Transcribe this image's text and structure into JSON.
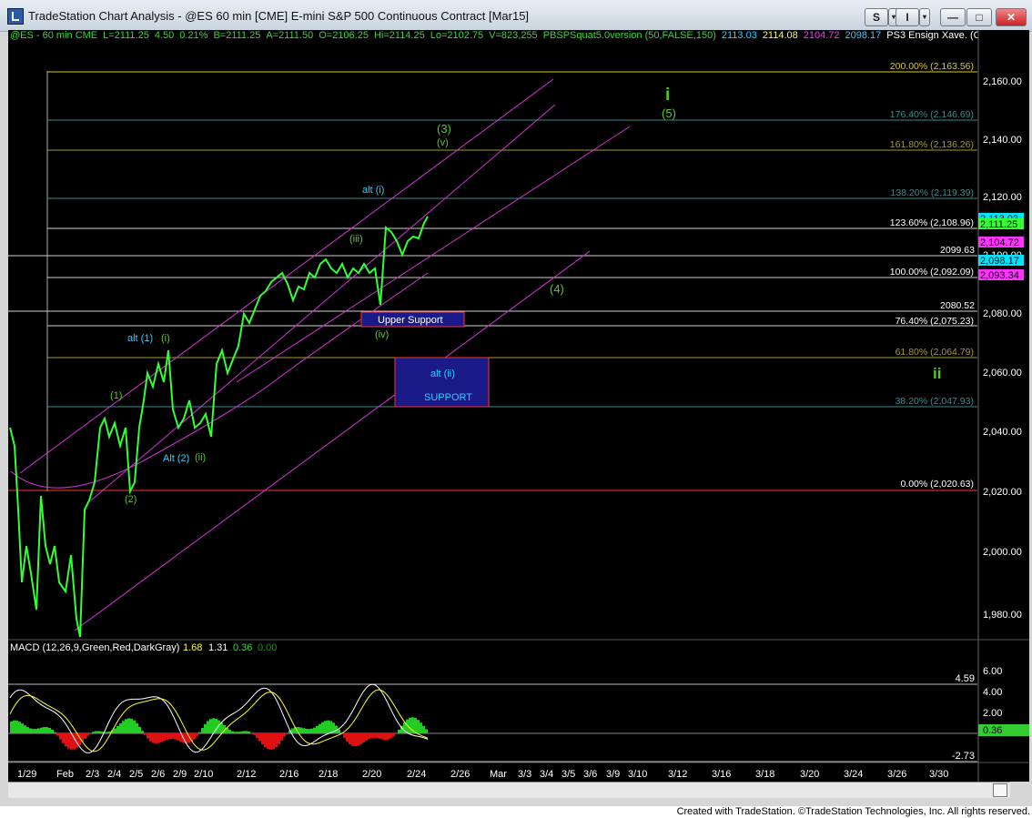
{
  "window": {
    "title": "TradeStation Chart Analysis - @ES 60 min [CME] E-mini S&P 500 Continuous Contract [Mar15]",
    "buttons": {
      "s": "S",
      "i": "I"
    }
  },
  "status_line": [
    {
      "text": "@ES - 60 min  CME",
      "color": "#39d639"
    },
    {
      "text": "L=2111.25",
      "color": "#39d639"
    },
    {
      "text": "4.50",
      "color": "#39d639"
    },
    {
      "text": "0.21%",
      "color": "#39d639"
    },
    {
      "text": "B=2111.25",
      "color": "#39d639"
    },
    {
      "text": "A=2111.50",
      "color": "#39d639"
    },
    {
      "text": "O=2106.25",
      "color": "#39d639"
    },
    {
      "text": "Hi=2114.25",
      "color": "#39d639"
    },
    {
      "text": "Lo=2102.75",
      "color": "#39d639"
    },
    {
      "text": "V=823,255",
      "color": "#39d639"
    },
    {
      "text": "PBSPSquat5.0version (50,FALSE,150)",
      "color": "#39d639"
    },
    {
      "text": "2113.03",
      "color": "#33ccff"
    },
    {
      "text": "2114.08",
      "color": "#ffff33"
    },
    {
      "text": "2104.72",
      "color": "#ff33ff"
    },
    {
      "text": "2098.17",
      "color": "#33ccff"
    },
    {
      "text": "PS3 Ensign Xave. (C",
      "color": "#ffffff"
    }
  ],
  "price_axis": {
    "ticks": [
      "2,160.00",
      "2,140.00",
      "2,120.00",
      "2,100.00",
      "2,080.00",
      "2,060.00",
      "2,040.00",
      "2,020.00",
      "2,000.00",
      "1,980.00"
    ],
    "tags": [
      {
        "text": "2,113.03",
        "bg": "#00e5ff"
      },
      {
        "text": "2,111.25",
        "bg": "#33ff33"
      },
      {
        "text": "2,104.72",
        "bg": "#ff33ff"
      },
      {
        "text": "2,098.17",
        "bg": "#00e5ff"
      },
      {
        "text": "2,093.34",
        "bg": "#ff33ff"
      }
    ]
  },
  "fib_levels": [
    {
      "label": "200.00% (2,163.56)",
      "color": "#d6c832"
    },
    {
      "label": "176.40% (2,146.69)",
      "color": "#3d8a8a"
    },
    {
      "label": "161.80% (2,136.26)",
      "color": "#a39a3a"
    },
    {
      "label": "138.20% (2,119.39)",
      "color": "#3d8a8a"
    },
    {
      "label": "123.60% (2,108.96)",
      "color": "#ffffff"
    },
    {
      "label": "100.00% (2,092.09)",
      "color": "#ffffff"
    },
    {
      "label": "76.40% (2,075.23)",
      "color": "#ffffff"
    },
    {
      "label": "61.80% (2,064.79)",
      "color": "#a39a3a"
    },
    {
      "label": "38.20% (2,047.93)",
      "color": "#3d8a8a"
    },
    {
      "label": "0.00% (2,020.63)",
      "color": "#ffffff"
    }
  ],
  "level_labels": [
    "2099.63",
    "2080.52"
  ],
  "wave_labels": {
    "big_i": "i",
    "five": "(5)",
    "three": "(3)",
    "v": "(v)",
    "alt_i": "alt (i)",
    "iii": "(iii)",
    "four": "(4)",
    "iv": "(iv)",
    "alt_1": "alt (1)",
    "i_small": "(i)",
    "one": "(1)",
    "alt_2": "Alt (2)",
    "ii_small": "(ii)",
    "two": "(2)",
    "big_ii": "ii"
  },
  "boxes": {
    "upper_support": "Upper Support",
    "alt_ii": "alt (ii)",
    "support": "SUPPORT"
  },
  "macd": {
    "title": "MACD (12,26,9,Green,Red,DarkGray)",
    "values": [
      {
        "text": "1.68",
        "color": "#ffff33"
      },
      {
        "text": "1.31",
        "color": "#ffffff"
      },
      {
        "text": "0.36",
        "color": "#39d639"
      },
      {
        "text": "0.00",
        "color": "#1f8f1f"
      }
    ],
    "axis": [
      "6.00",
      "4.00",
      "2.00"
    ],
    "ref_high": "4.59",
    "ref_low": "-2.73",
    "current": "0.36"
  },
  "time_axis": [
    "1/29",
    "Feb",
    "2/3",
    "2/4",
    "2/5",
    "2/6",
    "2/9",
    "2/10",
    "2/12",
    "2/16",
    "2/18",
    "2/20",
    "2/24",
    "2/26",
    "Mar",
    "3/3",
    "3/4",
    "3/5",
    "3/6",
    "3/9",
    "3/10",
    "3/12",
    "3/16",
    "3/18",
    "3/20",
    "3/24",
    "3/26",
    "3/30"
  ],
  "footer": "Created with TradeStation. ©TradeStation Technologies, Inc. All rights reserved."
}
